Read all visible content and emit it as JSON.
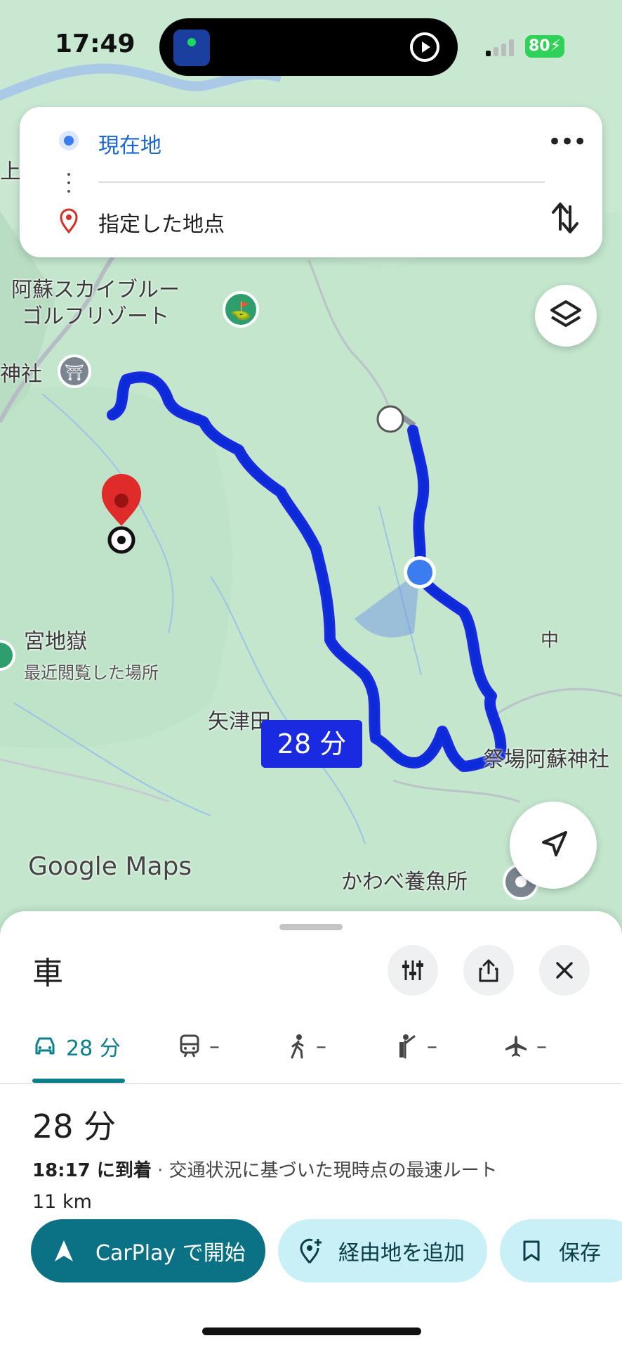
{
  "status_bar": {
    "time": "17:49",
    "battery": "80"
  },
  "search_card": {
    "origin": "現在地",
    "destination": "指定した地点"
  },
  "map": {
    "labels": {
      "golf": "阿蘇スカイブルー\nゴルフリゾート",
      "shrine": "神社",
      "left_top": "上",
      "miyajigoku": "宮地嶽",
      "recent": "最近閲覧した場所",
      "yatsuta": "矢津田",
      "naka": "中",
      "matsuriba": "祭場阿蘇神社",
      "kawabe": "かわべ養魚所"
    },
    "route_duration": "28 分",
    "logo": "Google Maps"
  },
  "sheet": {
    "title": "車",
    "modes": [
      {
        "icon": "car-icon",
        "label": "28 分"
      },
      {
        "icon": "train-icon",
        "label": "–"
      },
      {
        "icon": "walk-icon",
        "label": "–"
      },
      {
        "icon": "ride-icon",
        "label": "–"
      },
      {
        "icon": "flight-icon",
        "label": "–"
      }
    ],
    "duration": "28 分",
    "arrival_time": "18:17 に到着",
    "separator": " · ",
    "route_desc": "交通状況に基づいた現時点の最速ルート",
    "distance": "11 km",
    "buttons": {
      "start": "CarPlay で開始",
      "add_stop": "経由地を追加",
      "save": "保存"
    }
  },
  "colors": {
    "route": "#1a2ae0",
    "accent": "#0b7285",
    "light_accent": "#c9f0f7"
  }
}
